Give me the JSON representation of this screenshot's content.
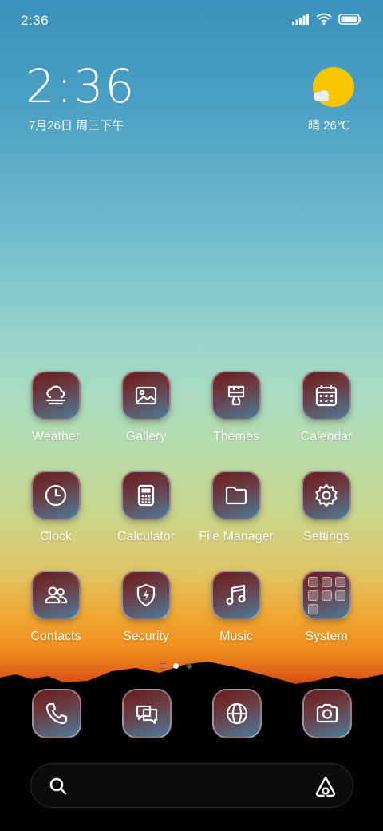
{
  "status_bar": {
    "time": "2:36",
    "icons": [
      "signal-icon",
      "wifi-icon",
      "battery-icon"
    ]
  },
  "clock_widget": {
    "time": "2:36",
    "date": "7月26日 周三下午"
  },
  "weather_widget": {
    "condition_icon": "sun-cloud-icon",
    "text": "晴 26℃"
  },
  "apps": [
    {
      "label": "Weather",
      "icon": "weather-icon"
    },
    {
      "label": "Gallery",
      "icon": "gallery-icon"
    },
    {
      "label": "Themes",
      "icon": "brush-icon"
    },
    {
      "label": "Calendar",
      "icon": "calendar-icon"
    },
    {
      "label": "Clock",
      "icon": "clock-icon"
    },
    {
      "label": "Calculator",
      "icon": "calculator-icon"
    },
    {
      "label": "File Manager",
      "icon": "folder-icon"
    },
    {
      "label": "Settings",
      "icon": "gear-icon"
    },
    {
      "label": "Contacts",
      "icon": "contacts-icon"
    },
    {
      "label": "Security",
      "icon": "shield-icon"
    },
    {
      "label": "Music",
      "icon": "music-icon"
    },
    {
      "label": "System",
      "icon": "folder-grid-icon"
    }
  ],
  "page_indicator": {
    "pages": 2,
    "active_page": 1
  },
  "dock": [
    {
      "icon": "phone-icon"
    },
    {
      "icon": "messages-icon"
    },
    {
      "icon": "browser-icon"
    },
    {
      "icon": "camera-icon"
    }
  ],
  "search_bar": {
    "left_icon": "search-icon",
    "right_icon": "assistant-icon"
  },
  "colors": {
    "sun": "#f7c600",
    "tile_top": "#6b1d1c",
    "tile_bottom": "#4e7b99"
  }
}
